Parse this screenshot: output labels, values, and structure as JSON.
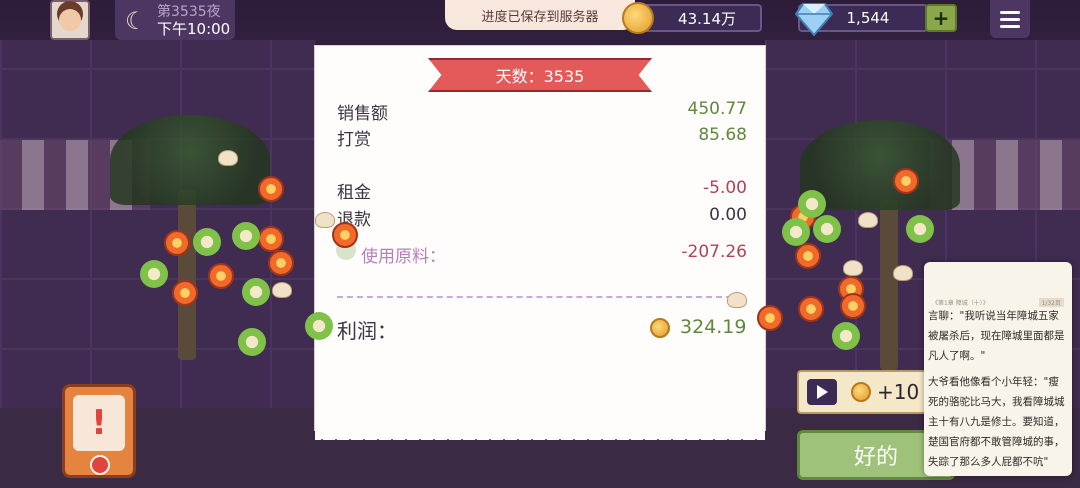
{
  "hud": {
    "night_label": "第3535夜",
    "time_label": "下午10:00",
    "toast": "进度已保存到服务器",
    "coins": "43.14万",
    "gems": "1,544",
    "plus": "+"
  },
  "receipt": {
    "day_title": "天数：3535",
    "rows": [
      {
        "label": "销售额",
        "value": "450.77"
      },
      {
        "label": "打赏",
        "value": "85.68"
      },
      {
        "label": "租金",
        "value": "-5.00"
      },
      {
        "label": "退款",
        "value": "0.00"
      },
      {
        "label": "使用原料：",
        "value": "-207.26"
      }
    ],
    "profit_label": "利润：",
    "profit_value": "324.19"
  },
  "ad": {
    "reward": "+10"
  },
  "ok_button": "好的",
  "book": {
    "header_left": "《第1章 障城（十）》",
    "header_right": "1/32页",
    "para1": "言聊：\"我听说当年障城五家被屠杀后，现在障城里面都是凡人了啊。\"",
    "para2": "大爷看他像看个小年轻：\"瘦死的骆驼比马大，我看障城城主十有八九是修士。要知道，楚国官府都不敢管障城的事，失踪了那么多人屁都不吭\""
  },
  "icons": [
    "moon-icon",
    "coin-icon",
    "gem-icon",
    "plus-icon",
    "menu-icon",
    "play-icon",
    "alert-icon"
  ]
}
